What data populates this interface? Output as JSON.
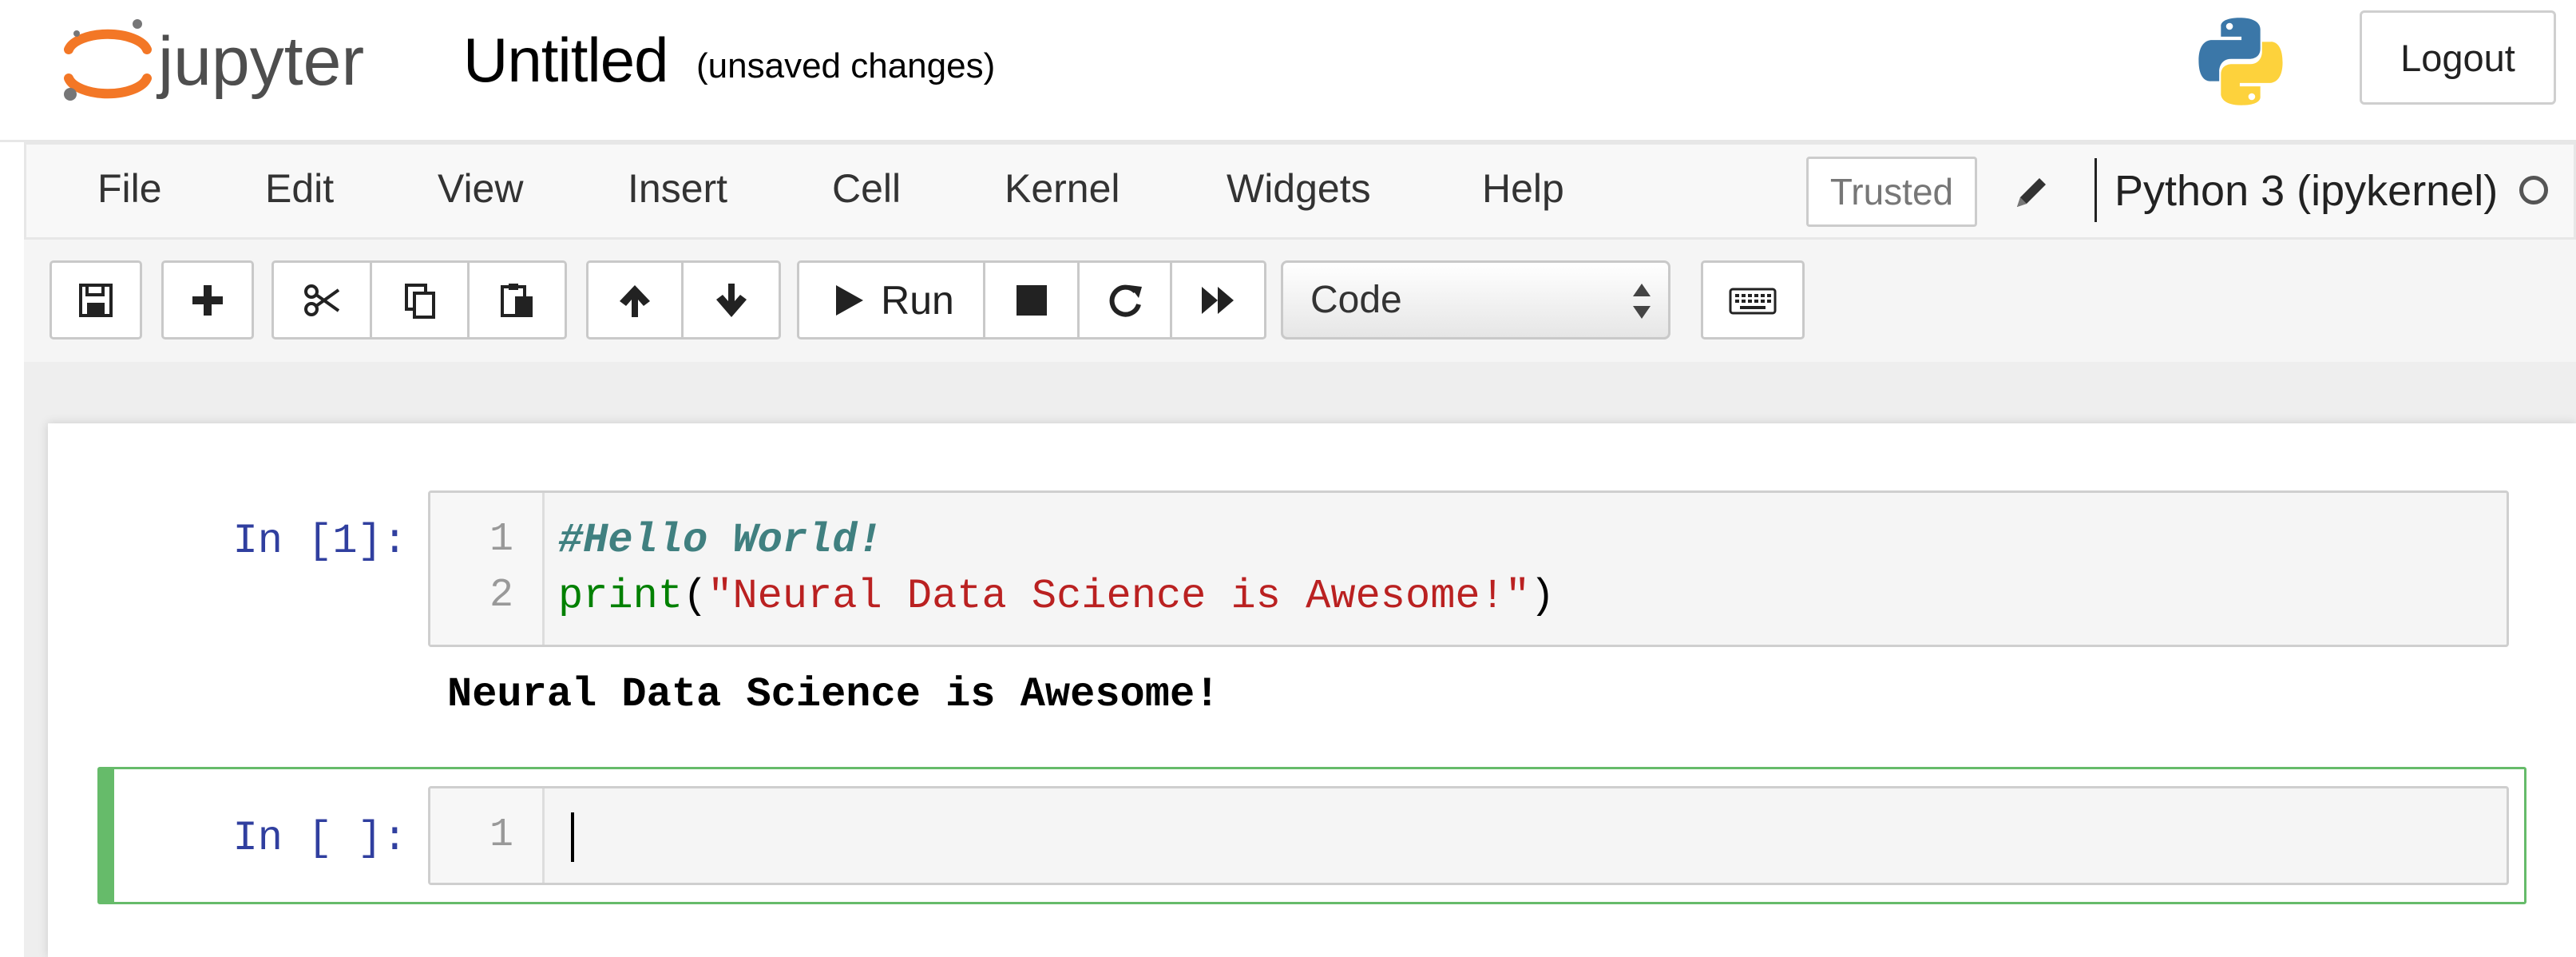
{
  "header": {
    "logo_text": "jupyter",
    "notebook_title": "Untitled",
    "save_status": "(unsaved changes)",
    "logout_label": "Logout"
  },
  "menubar": {
    "items": [
      "File",
      "Edit",
      "View",
      "Insert",
      "Cell",
      "Kernel",
      "Widgets",
      "Help"
    ],
    "trusted_label": "Trusted",
    "kernel_name": "Python 3 (ipykernel)"
  },
  "toolbar": {
    "run_label": "Run",
    "cell_type": "Code",
    "icons": [
      "save-icon",
      "plus-icon",
      "scissors-icon",
      "copy-icon",
      "paste-icon",
      "arrow-up-icon",
      "arrow-down-icon",
      "play-icon",
      "stop-icon",
      "restart-icon",
      "fast-forward-icon",
      "keyboard-icon"
    ]
  },
  "cells": [
    {
      "prompt": "In [1]:",
      "line_numbers": [
        "1",
        "2"
      ],
      "lines": [
        {
          "comment": "#Hello World!"
        },
        {
          "builtin": "print",
          "open": "(",
          "string": "\"Neural Data Science is Awesome!\"",
          "close": ")"
        }
      ],
      "output": "Neural Data Science is Awesome!"
    },
    {
      "prompt": "In [ ]:",
      "line_numbers": [
        "1"
      ],
      "selected": true
    }
  ],
  "colors": {
    "prompt": "#303f9f",
    "selected_cell_border": "#66bb6a",
    "comment": "#408080",
    "string": "#ba2121",
    "builtin": "#008000"
  }
}
